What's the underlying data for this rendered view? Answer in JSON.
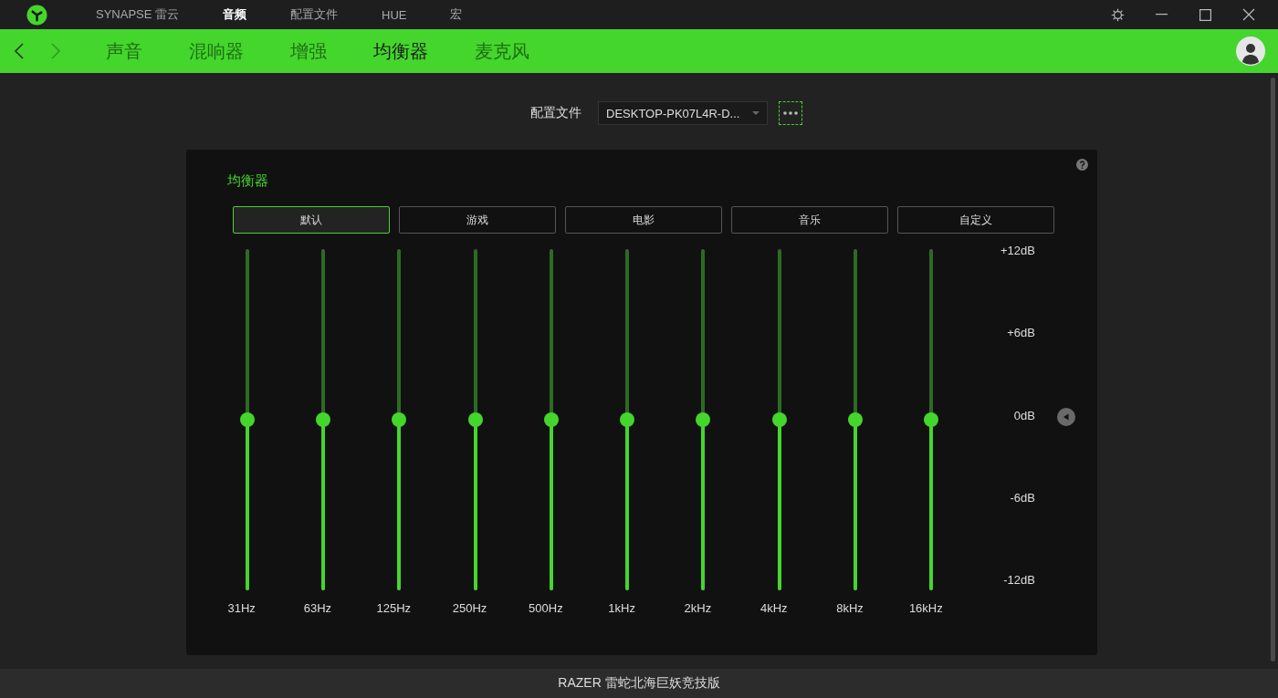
{
  "app_bar": {
    "tabs": [
      {
        "label": "SYNAPSE 雷云",
        "selected": false
      },
      {
        "label": "音频",
        "selected": true
      },
      {
        "label": "配置文件",
        "selected": false
      },
      {
        "label": "HUE",
        "selected": false
      },
      {
        "label": "宏",
        "selected": false
      }
    ]
  },
  "sub_nav": {
    "tabs": [
      {
        "label": "声音",
        "selected": false
      },
      {
        "label": "混响器",
        "selected": false
      },
      {
        "label": "增强",
        "selected": false
      },
      {
        "label": "均衡器",
        "selected": true
      },
      {
        "label": "麦克风",
        "selected": false
      }
    ]
  },
  "profile": {
    "label": "配置文件",
    "value": "DESKTOP-PK07L4R-D..."
  },
  "equalizer": {
    "title": "均衡器",
    "presets": [
      {
        "label": "默认",
        "selected": true
      },
      {
        "label": "游戏",
        "selected": false
      },
      {
        "label": "电影",
        "selected": false
      },
      {
        "label": "音乐",
        "selected": false
      },
      {
        "label": "自定义",
        "selected": false
      }
    ],
    "bands": [
      {
        "label": "31Hz",
        "level": 0.5
      },
      {
        "label": "63Hz",
        "level": 0.5
      },
      {
        "label": "125Hz",
        "level": 0.5
      },
      {
        "label": "250Hz",
        "level": 0.5
      },
      {
        "label": "500Hz",
        "level": 0.5
      },
      {
        "label": "1kHz",
        "level": 0.5
      },
      {
        "label": "2kHz",
        "level": 0.5
      },
      {
        "label": "4kHz",
        "level": 0.5
      },
      {
        "label": "8kHz",
        "level": 0.5
      },
      {
        "label": "16kHz",
        "level": 0.5
      }
    ],
    "scale": [
      "+12dB",
      "+6dB",
      "0dB",
      "-6dB",
      "-12dB"
    ]
  },
  "footer": {
    "device": "RAZER 雷蛇北海巨妖竞技版"
  }
}
